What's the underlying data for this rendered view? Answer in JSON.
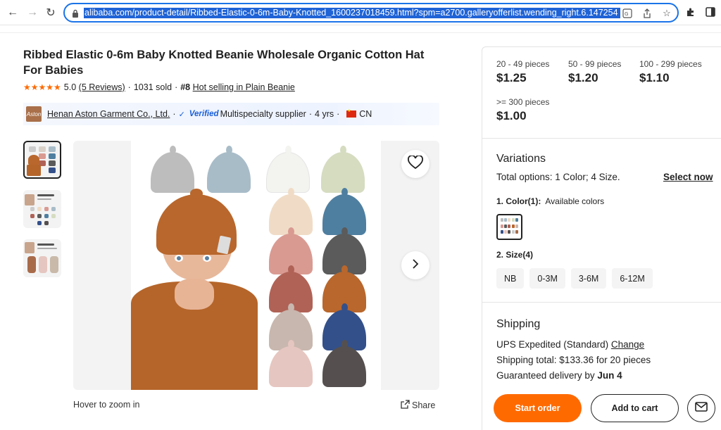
{
  "browser": {
    "url": "alibaba.com/product-detail/Ribbed-Elastic-0-6m-Baby-Knotted_1600237018459.html?spm=a2700.galleryofferlist.wending_right.6.147254"
  },
  "product": {
    "title": "Ribbed Elastic 0-6m Baby Knotted Beanie Wholesale Organic Cotton Hat For Babies",
    "rating": "5.0",
    "reviews": "(5 Reviews)",
    "sold": "1031 sold",
    "rank": "#8",
    "rank_text": "Hot selling in Plain Beanie",
    "supplier_logo_text": "Aston",
    "supplier_name": "Henan Aston Garment Co., Ltd.",
    "verified": "Verified",
    "supplier_type": "Multispecialty supplier",
    "years": "4 yrs",
    "country": "CN",
    "hover_zoom": "Hover to zoom in",
    "share": "Share"
  },
  "pricing": {
    "tiers": [
      {
        "qty": "20 - 49 pieces",
        "price": "$1.25"
      },
      {
        "qty": "50 - 99 pieces",
        "price": "$1.20"
      },
      {
        "qty": "100 - 299 pieces",
        "price": "$1.10"
      },
      {
        "qty": ">= 300 pieces",
        "price": "$1.00"
      }
    ]
  },
  "variations": {
    "heading": "Variations",
    "total": "Total options: 1 Color; 4 Size.",
    "select_now": "Select now",
    "color_label": "1. Color(1):",
    "color_note": "Available colors",
    "size_label": "2. Size(4)",
    "sizes": [
      "NB",
      "0-3M",
      "3-6M",
      "6-12M"
    ]
  },
  "shipping": {
    "heading": "Shipping",
    "method": "UPS Expedited (Standard)",
    "change": "Change",
    "total": "Shipping total: $133.36 for 20 pieces",
    "delivery_prefix": "Guaranteed delivery by",
    "delivery_date": "Jun 4"
  },
  "actions": {
    "start_order": "Start order",
    "add_to_cart": "Add to cart"
  },
  "colors": {
    "accent": "#ff6a00",
    "omnibox_border": "#1a73e8",
    "verified_blue": "#1a5fd8"
  },
  "hat_colors": [
    "#bdbdbd",
    "#a8bcc8",
    "#f3f3ef",
    "#d5dcc0",
    "#f0dcc6",
    "#4f7fa0",
    "#d99a92",
    "#5b5b5b",
    "#b06256",
    "#b9672c",
    "#c8b7ae",
    "#33508a",
    "#e6c6c0",
    "#55504f"
  ]
}
